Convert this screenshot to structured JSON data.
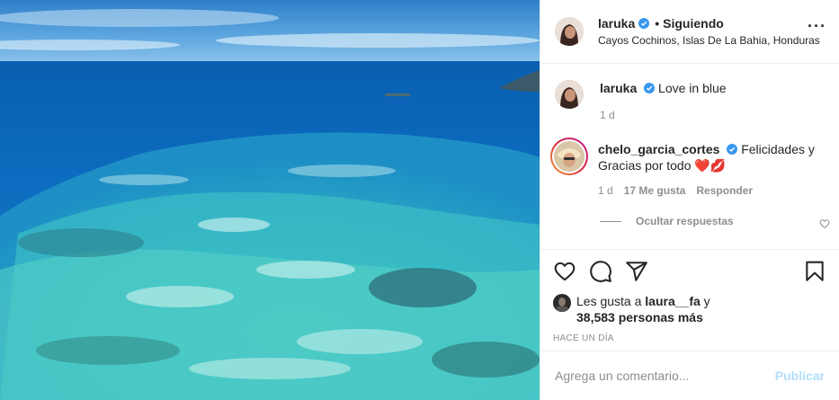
{
  "post": {
    "author": "laruka",
    "follow_status": "Siguiendo",
    "location": "Cayos Cochinos, Islas De La Bahia, Honduras",
    "more_icon": "more-options-icon"
  },
  "caption": {
    "username": "laruka",
    "text": "Love in blue",
    "time": "1 d"
  },
  "comments": [
    {
      "username": "chelo_garcia_cortes",
      "text": "Felicidades y Gracias por todo ❤️💋",
      "time": "1 d",
      "likes": "17 Me gusta",
      "reply_label": "Responder"
    }
  ],
  "hide_replies_label": "Ocultar respuestas",
  "actions": {
    "icons": [
      "heart-icon",
      "comment-icon",
      "share-icon",
      "bookmark-icon"
    ]
  },
  "likes": {
    "prefix": "Les gusta a",
    "user": "laura__fa",
    "conjunction": "y",
    "count": "38,583 personas más"
  },
  "timeago": "Hace un día",
  "add_comment": {
    "placeholder": "Agrega un comentario...",
    "publish_label": "Publicar"
  },
  "colors": {
    "verified": "#3897f0",
    "publish_disabled": "#b2dffc",
    "secondary_text": "#8e8e8e"
  }
}
